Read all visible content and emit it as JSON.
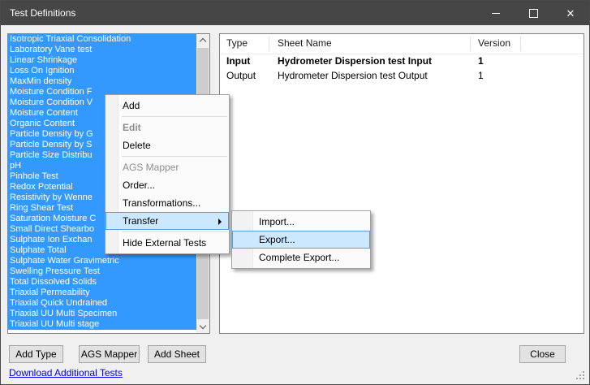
{
  "window": {
    "title": "Test Definitions"
  },
  "titlebar": {
    "icons": {
      "minimize": "minimize-dash",
      "maximize": "maximize-square",
      "close": "✕"
    }
  },
  "test_list": {
    "items": [
      "Isotropic Triaxial Consolidation",
      "Laboratory Vane test",
      "Linear Shrinkage",
      "Loss On Ignition",
      "MaxMin density",
      "Moisture Condition F",
      "Moisture Condition V",
      "Moisture Content",
      "Organic Content",
      "Particle Density by G",
      "Particle Density by S",
      "Particle Size Distribu",
      "pH",
      "Pinhole Test",
      "Redox Potential",
      "Resistivity by Wenne",
      "Ring Shear Test",
      "Saturation Moisture C",
      "Small Direct Shearbo",
      "Sulphate Ion Exchan",
      "Sulphate Total",
      "Sulphate Water Gravimetric",
      "Swelling Pressure Test",
      "Total Dissolved Solids",
      "Triaxial Permeability",
      "Triaxial Quick Undrained",
      "Triaxial UU Multi Specimen",
      "Triaxial UU Multi stage"
    ]
  },
  "sheet_table": {
    "columns": [
      "Type",
      "Sheet Name",
      "Version"
    ],
    "rows": [
      {
        "type": "Input",
        "sheet_name": "Hydrometer Dispersion test Input",
        "version": "1",
        "bold": true
      },
      {
        "type": "Output",
        "sheet_name": "Hydrometer Dispersion test Output",
        "version": "1"
      }
    ]
  },
  "context_menu": {
    "items": [
      {
        "label": "Add"
      },
      {
        "separator": true
      },
      {
        "label": "Edit",
        "disabled": true,
        "bold": true
      },
      {
        "label": "Delete"
      },
      {
        "separator": true
      },
      {
        "label": "AGS Mapper",
        "disabled": true
      },
      {
        "label": "Order..."
      },
      {
        "label": "Transformations..."
      },
      {
        "label": "Transfer",
        "highlighted": true,
        "submenu": true
      },
      {
        "separator": true
      },
      {
        "label": "Hide External Tests"
      }
    ]
  },
  "transfer_submenu": {
    "items": [
      {
        "label": "Import..."
      },
      {
        "label": "Export...",
        "highlighted": true
      },
      {
        "label": "Complete Export..."
      }
    ]
  },
  "buttons": {
    "add_type": "Add Type",
    "ags_mapper": "AGS Mapper",
    "add_sheet": "Add Sheet",
    "close": "Close"
  },
  "footer": {
    "download_link": "Download Additional Tests"
  },
  "colors": {
    "titlebar": "#464646",
    "selection_blue": "#3399FF",
    "menu_highlight_fill": "#CCE8FF",
    "menu_highlight_border": "#5A9EDC",
    "link_blue": "#0000EE",
    "dialog_background": "#F0F0F0"
  }
}
